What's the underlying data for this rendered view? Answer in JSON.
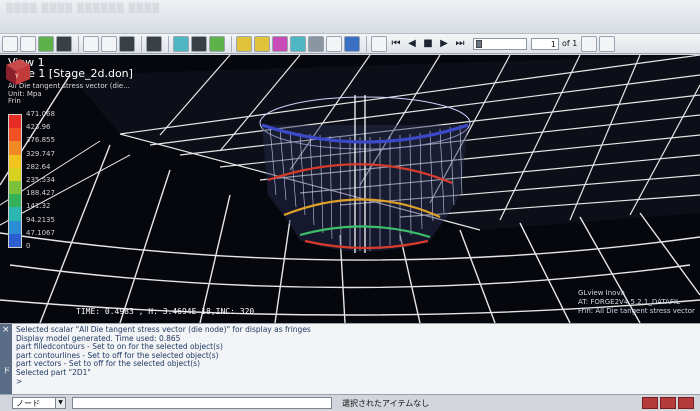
{
  "toolbar": {
    "frame_value": "1",
    "frame_of": "of 1",
    "playback": [
      "⏮",
      "◀",
      "■",
      "▶",
      "⏭"
    ]
  },
  "viewport": {
    "view_title": "View 1",
    "case_title": "Case 1 [Stage_2d.don]",
    "scalar_name": "All Die tangent stress vector (die...",
    "unit": "Unit: Mpa",
    "frin": "Frin",
    "status": "TIME: 0.4983  , H: 3.4694E-18,INC: 320",
    "info_lines": [
      "GLview Inova",
      "AT:   FORGE2V4.5.2.1_DATAFIL",
      "Frin:  All Die tangent stress vector"
    ],
    "legend": {
      "values": [
        "471.068",
        "423.96",
        "376.855",
        "329.747",
        "282.64",
        "235.534",
        "188.427",
        "141.32",
        "94.2135",
        "47.1067",
        "0"
      ],
      "colors": [
        "#e72b25",
        "#f05225",
        "#f08a24",
        "#f2c21d",
        "#d6d21f",
        "#7bc23a",
        "#36b15a",
        "#2bb6b2",
        "#2b8ed4",
        "#2b5fd0",
        "#2436b8"
      ]
    },
    "colors": {
      "background": "#06070d",
      "mesh": "#e6e6e6",
      "vectors": "#cfd3ff",
      "fringe_red": "#d63b2b",
      "fringe_blue": "#3c49c8"
    }
  },
  "console": {
    "lines": [
      "Selected scalar \"All Die tangent stress vector (die node)\" for display as fringes",
      "Display model generated. Time used: 0.865",
      "part filledcontours - Set to on for the selected object(s)",
      "part contourlines - Set to off for the selected object(s)",
      "part vectors - Set to off for the selected object(s)",
      "Selected part \"2D1\"",
      ">"
    ],
    "tab_label": "コマンド"
  },
  "bottombar": {
    "node_select": "ノード",
    "selection_status": "選択されたアイテムなし"
  }
}
